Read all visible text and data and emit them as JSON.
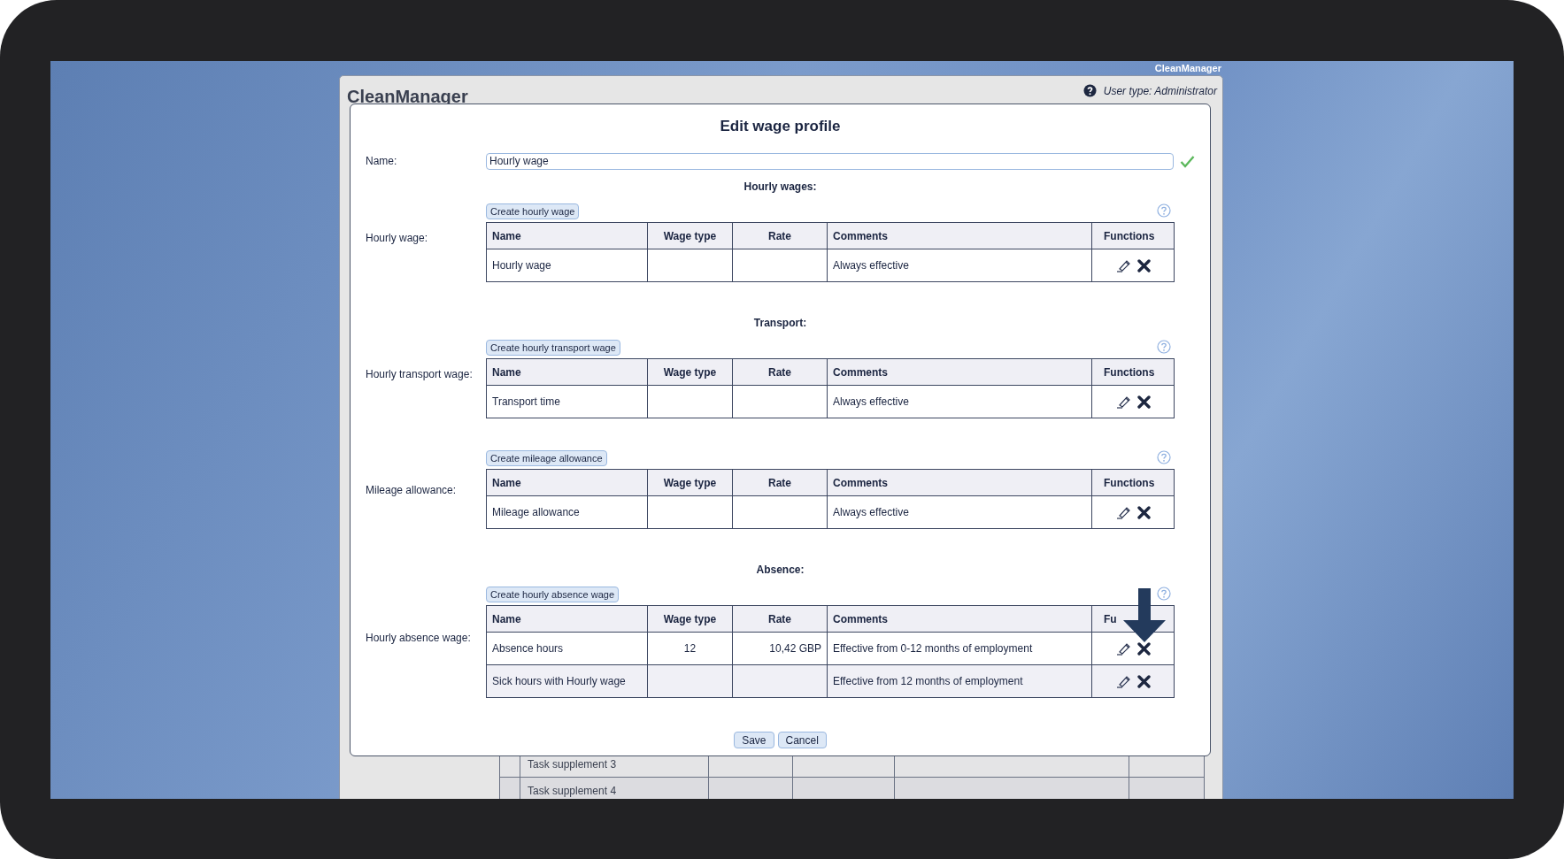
{
  "desktop": {
    "corner_label": "CleanManager"
  },
  "app": {
    "title": "CleanManager",
    "user_type": "User type: Administrator",
    "background_rows": [
      {
        "name": "Task supplement 3"
      },
      {
        "name": "Task supplement 4"
      }
    ]
  },
  "dialog": {
    "title": "Edit wage profile",
    "name_label": "Name:",
    "name_value": "Hourly wage",
    "name_valid": true,
    "sections": [
      {
        "heading": "Hourly wages:",
        "label": "Hourly wage:",
        "button": "Create hourly wage",
        "columns": [
          "Name",
          "Wage type",
          "Rate",
          "Comments",
          "Functions"
        ],
        "rows": [
          {
            "name": "Hourly wage",
            "comments": "Always effective"
          }
        ]
      },
      {
        "heading": "Transport:",
        "label": "Hourly transport wage:",
        "button": "Create hourly transport wage",
        "columns": [
          "Name",
          "Wage type",
          "Rate",
          "Comments",
          "Functions"
        ],
        "rows": [
          {
            "name": "Transport time",
            "comments": "Always effective"
          }
        ]
      },
      {
        "label": "Mileage allowance:",
        "button": "Create mileage allowance",
        "columns": [
          "Name",
          "Wage type",
          "Rate",
          "Comments",
          "Functions"
        ],
        "rows": [
          {
            "name": "Mileage allowance",
            "comments": "Always effective"
          }
        ]
      },
      {
        "heading": "Absence:",
        "label": "Hourly absence wage:",
        "button": "Create hourly absence wage",
        "columns": [
          "Name",
          "Wage type",
          "Rate",
          "Comments",
          "Fu"
        ],
        "rows": [
          {
            "name": "Absence hours",
            "wage_type": "12",
            "rate": "10,42 GBP",
            "comments": "Effective from 0-12 months of employment"
          },
          {
            "name": "Sick hours with Hourly wage",
            "comments": "Effective from 12 months of employment"
          }
        ]
      }
    ],
    "buttons": [
      "Save",
      "Cancel"
    ]
  },
  "annotation": {
    "kind": "arrow"
  }
}
